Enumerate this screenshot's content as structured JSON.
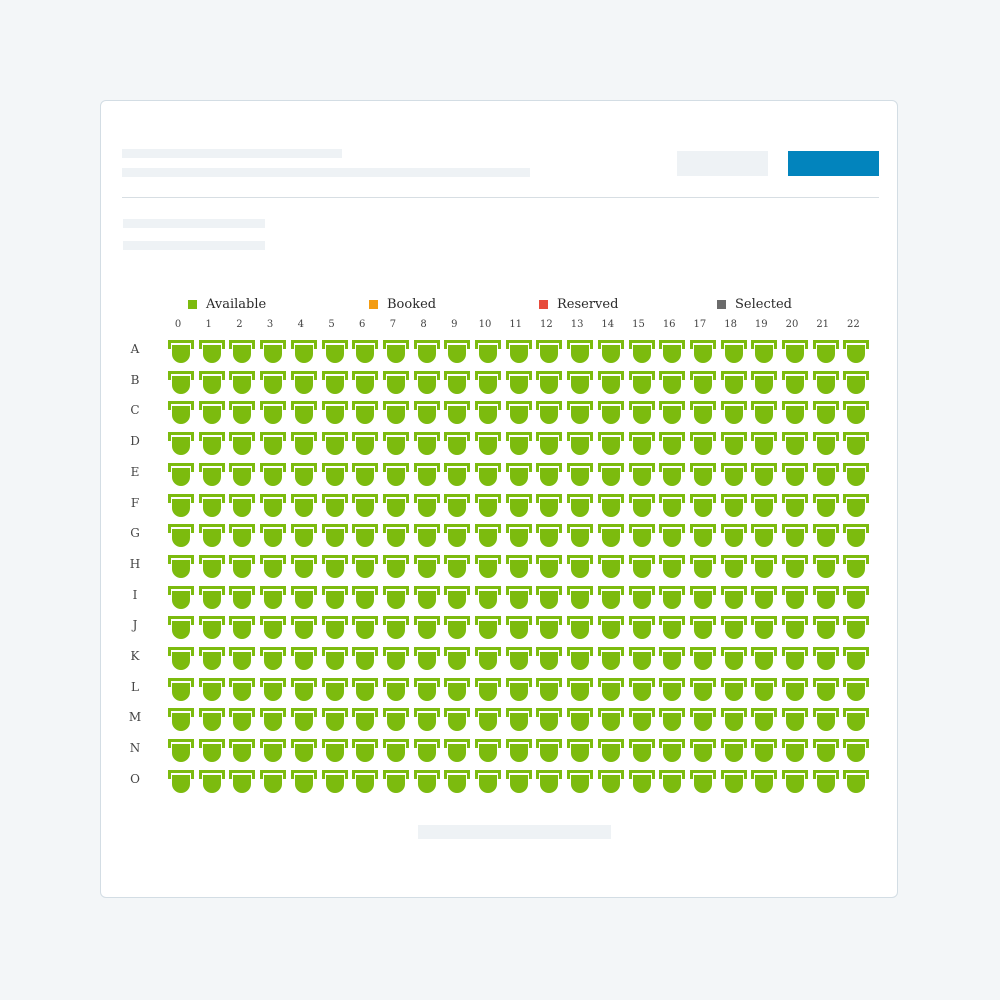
{
  "legend": {
    "available": "Available",
    "booked": "Booked",
    "reserved": "Reserved",
    "selected": "Selected"
  },
  "colors": {
    "available": "#7cbb0e",
    "booked": "#f39c12",
    "reserved": "#e74c3c",
    "selected": "#6b6b6b",
    "primary_button": "#0284bd"
  },
  "columns": [
    "0",
    "1",
    "2",
    "3",
    "4",
    "5",
    "6",
    "7",
    "8",
    "9",
    "10",
    "11",
    "12",
    "13",
    "14",
    "15",
    "16",
    "17",
    "18",
    "19",
    "20",
    "21",
    "22"
  ],
  "rows": [
    "A",
    "B",
    "C",
    "D",
    "E",
    "F",
    "G",
    "H",
    "I",
    "J",
    "K",
    "L",
    "M",
    "N",
    "O"
  ],
  "seat_status_default": "available",
  "seat_icon": "armchair-icon"
}
